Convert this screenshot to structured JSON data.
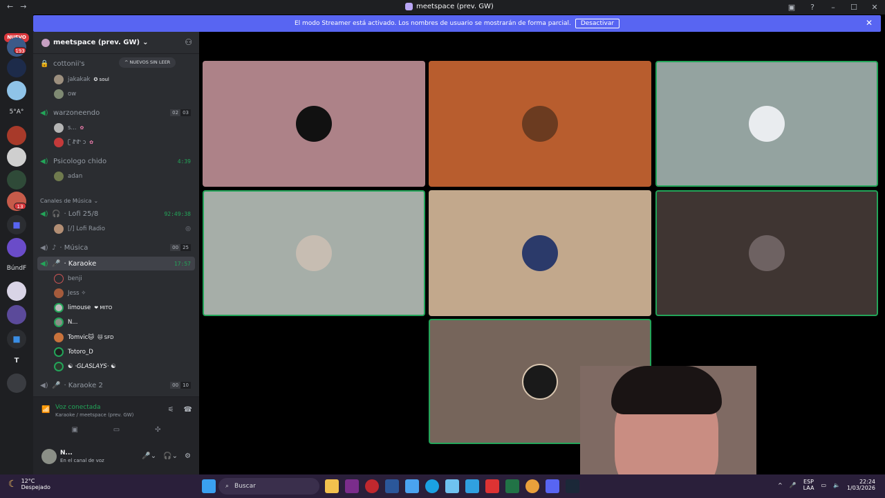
{
  "window": {
    "title": "meetspace (prev. GW)",
    "back_glyph": "←",
    "forward_glyph": "→"
  },
  "streamer_bar": {
    "message": "El modo Streamer está activado. Los nombres de usuario se mostrarán de forma parcial.",
    "button": "Desactivar"
  },
  "guild_rail": {
    "new_badge": "NUEVO",
    "badge1": "193",
    "badge2": "13",
    "text1": "5°A°",
    "text2": "BúndF",
    "text3": "T"
  },
  "server": {
    "name": "meetspace (prev. GW)"
  },
  "channels": {
    "ch1": {
      "name": "cottonii's",
      "unread_pill": "^ NUEVOS SIN LEER",
      "users": [
        {
          "name": "jakakak",
          "tag": "✪ soul"
        },
        {
          "name": "ow"
        }
      ]
    },
    "ch2": {
      "name": "warzoneendo",
      "count_a": "02",
      "count_b": "03",
      "users": [
        {
          "name": "s..."
        },
        {
          "name": "ʗ ᏑᏑ ɔ"
        }
      ]
    },
    "ch3": {
      "name": "Psicologo chido",
      "timer": "4:39",
      "users": [
        {
          "name": "adan"
        }
      ]
    },
    "category": "Canales de Música",
    "ch4": {
      "name": "· Lofi 25/8",
      "timer": "92:49:38",
      "users": [
        {
          "name": "[/] Lofi Radio"
        }
      ]
    },
    "ch5": {
      "name": "· Música",
      "count_a": "00",
      "count_b": "25"
    },
    "ch6": {
      "name": "· Karaoke",
      "timer": "17:57",
      "users": [
        {
          "name": "benji"
        },
        {
          "name": "Jess ✧"
        },
        {
          "name": "limouse",
          "tag": "❤ MITO"
        },
        {
          "name": "N..."
        },
        {
          "name": "Tomvic🐱",
          "tag": "🐱 SFD"
        },
        {
          "name": "Totoro_D"
        },
        {
          "name": "☯ ·GLASLAYS· ☯"
        }
      ]
    },
    "ch7": {
      "name": "· Karaoke 2",
      "count_a": "00",
      "count_b": "10"
    }
  },
  "voice_panel": {
    "status": "Voz conectada",
    "location": "Karaoke / meetspace (prev. GW)"
  },
  "user_panel": {
    "name": "N...",
    "status": "En el canal de voz"
  },
  "taskbar": {
    "temp": "12°C",
    "condition": "Despejado",
    "search": "Buscar",
    "lang": "ESP",
    "region": "LAA",
    "time": "22:24",
    "date": "1/03/2026"
  },
  "colors": {
    "accent": "#5865f2",
    "speaking": "#23a559",
    "danger": "#da373c"
  },
  "tiles": [
    {
      "bg": "#ad8288"
    },
    {
      "bg": "#b85d2e"
    },
    {
      "bg": "#94a3a0"
    },
    {
      "bg": "#a6aea8"
    },
    {
      "bg": "#c2a88c"
    },
    {
      "bg": "#3f3532"
    },
    {
      "bg": "#76655b"
    }
  ]
}
